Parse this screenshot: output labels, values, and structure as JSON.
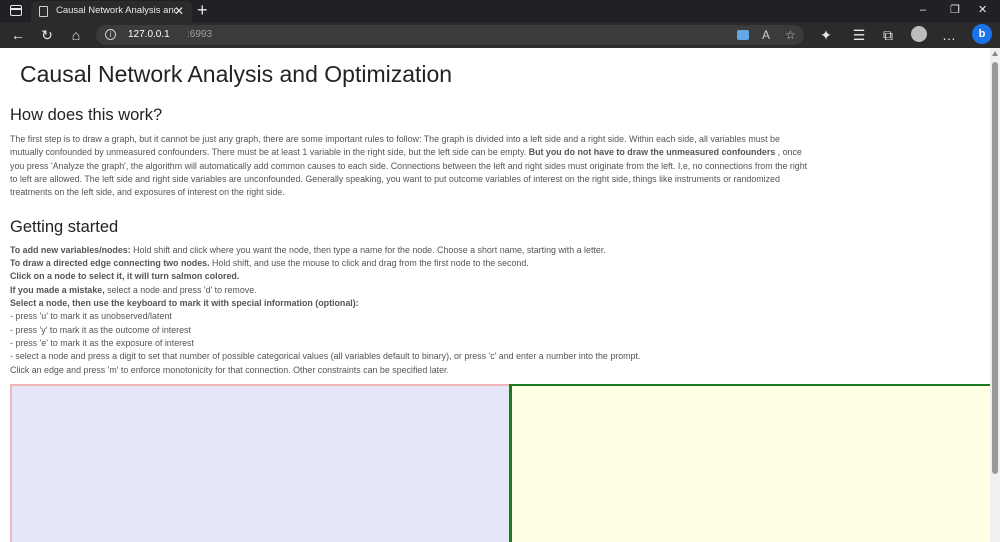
{
  "browser": {
    "tab_title": "Causal Network Analysis and Op",
    "tab_close": "✕",
    "new_tab": "+",
    "url_host": "127.0.0.1",
    "url_port": ":6993",
    "window_controls": [
      "–",
      "❐",
      "✕"
    ]
  },
  "page": {
    "title": "Causal Network Analysis and Optimization",
    "how_heading": "How does this work?",
    "how_text_1": "The first step is to draw a graph, but it cannot be just any graph, there are some important rules to follow: The graph is divided into a left side and a right side. Within each side, all variables must be mutually confounded by unmeasured confounders. There must be at least 1 variable in the right side, but the left side can be empty. ",
    "how_text_bold": "But you do not have to draw the unmeasured confounders",
    "how_text_2": " , once you press 'Analyze the graph', the algorithm will automatically add common causes to each side. Connections between the left and right sides must originate from the left. I.e, no connections from the right to left are allowed. The left side and right side variables are unconfounded. Generally speaking, you want to put outcome variables of interest on the right side, things like instruments or randomized treatments on the left side, and exposures of interest on the right side.",
    "start_heading": "Getting started",
    "instructions": [
      {
        "bold": "To add new variables/nodes:",
        "text": " Hold shift and click where you want the node, then type a name for the node. Choose a short name, starting with a letter."
      },
      {
        "bold": "To draw a directed edge connecting two nodes.",
        "text": " Hold shift, and use the mouse to click and drag from the first node to the second."
      },
      {
        "bold": "Click on a node to select it, it will turn salmon colored.",
        "text": ""
      },
      {
        "bold": "If you made a mistake,",
        "text": " select a node and press 'd' to remove."
      },
      {
        "bold": "Select a node, then use the keyboard to mark it with special information (optional):",
        "text": ""
      },
      {
        "bold": "",
        "text": "- press 'u' to mark it as unobserved/latent"
      },
      {
        "bold": "",
        "text": "- press 'y' to mark it as the outcome of interest"
      },
      {
        "bold": "",
        "text": "- press 'e' to mark it as the exposure of interest"
      },
      {
        "bold": "",
        "text": "- select a node and press a digit to set that number of possible categorical values (all variables default to binary), or press 'c' and enter a number into the prompt."
      },
      {
        "bold": "",
        "text": "Click an edge and press 'm' to enforce monotonicity for that connection. Other constraints can be specified later."
      }
    ]
  },
  "colors": {
    "left_canvas_bg": "#e6e6fb",
    "left_canvas_border": "#f0b6b6",
    "right_canvas_bg": "#ffffe6",
    "right_canvas_border": "#1e7a1e"
  }
}
